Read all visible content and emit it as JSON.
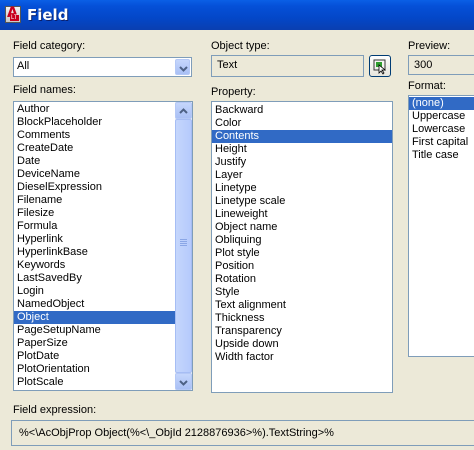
{
  "window": {
    "title": "Field"
  },
  "field_category": {
    "label": "Field category:",
    "value": "All"
  },
  "field_names": {
    "label": "Field names:",
    "items": [
      "Author",
      "BlockPlaceholder",
      "Comments",
      "CreateDate",
      "Date",
      "DeviceName",
      "DieselExpression",
      "Filename",
      "Filesize",
      "Formula",
      "Hyperlink",
      "HyperlinkBase",
      "Keywords",
      "LastSavedBy",
      "Login",
      "NamedObject",
      "Object",
      "PageSetupName",
      "PaperSize",
      "PlotDate",
      "PlotOrientation",
      "PlotScale"
    ],
    "selected": "Object"
  },
  "object_type": {
    "label": "Object type:",
    "value": "Text"
  },
  "select_object_button": {
    "icon": "select-object-icon"
  },
  "property": {
    "label": "Property:",
    "items": [
      "Backward",
      "Color",
      "Contents",
      "Height",
      "Justify",
      "Layer",
      "Linetype",
      "Linetype scale",
      "Lineweight",
      "Object name",
      "Obliquing",
      "Plot style",
      "Position",
      "Rotation",
      "Style",
      "Text alignment",
      "Thickness",
      "Transparency",
      "Upside down",
      "Width factor"
    ],
    "selected": "Contents"
  },
  "preview": {
    "label": "Preview:",
    "value": "300"
  },
  "format": {
    "label": "Format:",
    "items": [
      "(none)",
      "Uppercase",
      "Lowercase",
      "First capital",
      "Title case"
    ],
    "selected": "(none)"
  },
  "field_expression": {
    "label": "Field expression:",
    "value": "%<\\AcObjProp Object(%<\\_ObjId 2128876936>%).TextString>%"
  },
  "colors": {
    "title_bar": "#0550d8",
    "selection": "#316ac5",
    "dialog_bg": "#ece9d8"
  }
}
